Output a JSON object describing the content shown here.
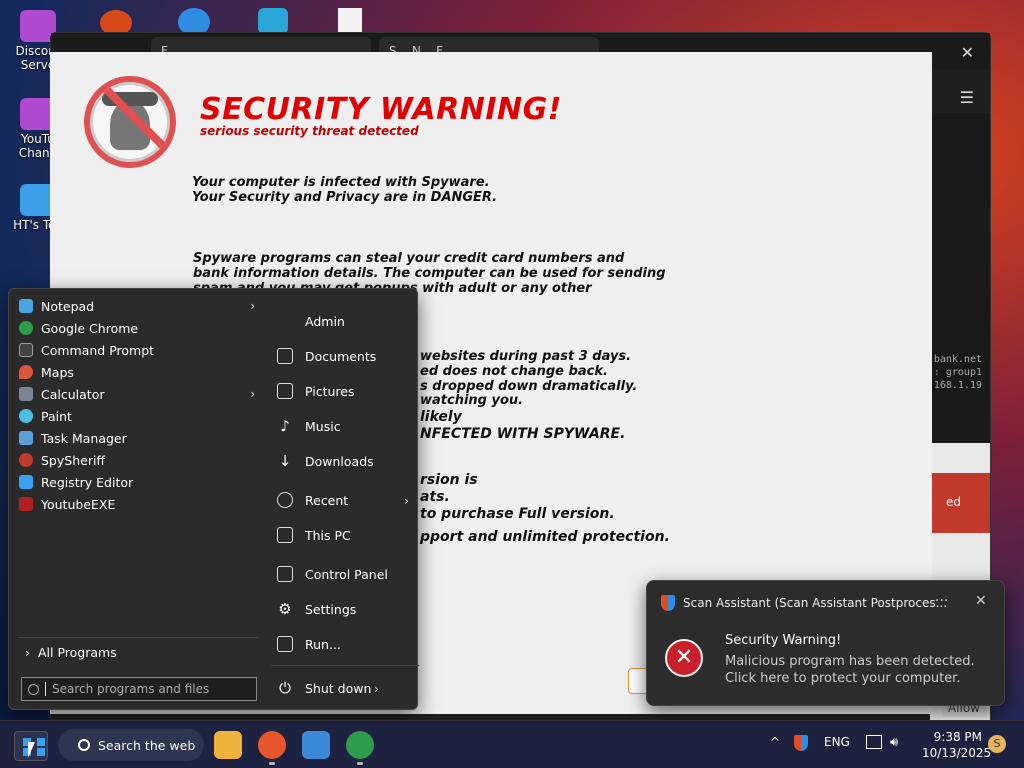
{
  "desktop": {
    "icons": [
      {
        "label": "Discord Serve",
        "color": "#b04ad0"
      },
      {
        "label": "YouTu Chann",
        "color": "#b04ad0"
      },
      {
        "label": "HT's Too",
        "color": "#3a9ee8"
      }
    ]
  },
  "browser_bg": {
    "tabs": [
      "F...",
      "S... N... F..."
    ],
    "code_lines": [
      "bank.net",
      ": group1",
      "168.1.19"
    ],
    "red_label": "ed",
    "allow": "Allow"
  },
  "scam_page": {
    "title": "SECURITY WARNING!",
    "subtitle": "serious security threat detected",
    "lines": [
      "Your computer is infected with Spyware.",
      "Your Security and Privacy are in DANGER.",
      "Spyware programs can steal your credit card numbers and",
      "bank information details. The computer can be used for sending",
      "spam and you may get popups with adult or any other",
      "websites during past 3 days.",
      "ed does not change back.",
      "s dropped down dramatically.",
      "watching you.",
      "likely",
      "NFECTED WITH SPYWARE.",
      "rsion is",
      "ats.",
      "to purchase Full version.",
      "pport and unlimited protection."
    ]
  },
  "start_menu": {
    "programs": [
      {
        "label": "Notepad",
        "color": "#4aa3e0",
        "submenu": true
      },
      {
        "label": "Google Chrome",
        "color": "#2e9c4a",
        "submenu": false
      },
      {
        "label": "Command Prompt",
        "color": "#444444",
        "submenu": false
      },
      {
        "label": "Maps",
        "color": "#e0553a",
        "submenu": false
      },
      {
        "label": "Calculator",
        "color": "#7b8694",
        "submenu": true
      },
      {
        "label": "Paint",
        "color": "#4ac0e0",
        "submenu": false
      },
      {
        "label": "Task Manager",
        "color": "#5aa0d8",
        "submenu": false
      },
      {
        "label": "SpySheriff",
        "color": "#c0392b",
        "submenu": false
      },
      {
        "label": "Registry Editor",
        "color": "#3aa0f0",
        "submenu": false
      },
      {
        "label": "YoutubeEXE",
        "color": "#b02020",
        "submenu": false
      }
    ],
    "all_programs": "All Programs",
    "search_placeholder": "Search programs and files",
    "right_items": [
      {
        "label": "Admin",
        "submenu": false
      },
      {
        "label": "Documents",
        "submenu": false
      },
      {
        "label": "Pictures",
        "submenu": false
      },
      {
        "label": "Music",
        "submenu": false
      },
      {
        "label": "Downloads",
        "submenu": false
      },
      {
        "label": "Recent",
        "submenu": true
      },
      {
        "label": "This PC",
        "submenu": false
      },
      {
        "label": "Control Panel",
        "submenu": false
      },
      {
        "label": "Settings",
        "submenu": false
      },
      {
        "label": "Run...",
        "submenu": false
      }
    ],
    "shutdown": "Shut down"
  },
  "toast": {
    "app": "Scan Assistant (Scan Assistant Postproces...",
    "more": "···",
    "close": "✕",
    "icon_glyph": "✕",
    "title": "Security Warning!",
    "line1": "Malicious program has been detected.",
    "line2": "Click here to protect your computer."
  },
  "taskbar": {
    "search_label": "Search the web",
    "language": "ENG",
    "time": "9:38 PM",
    "date": "10/13/2025",
    "badge": "S",
    "tray_chevron": "^"
  }
}
